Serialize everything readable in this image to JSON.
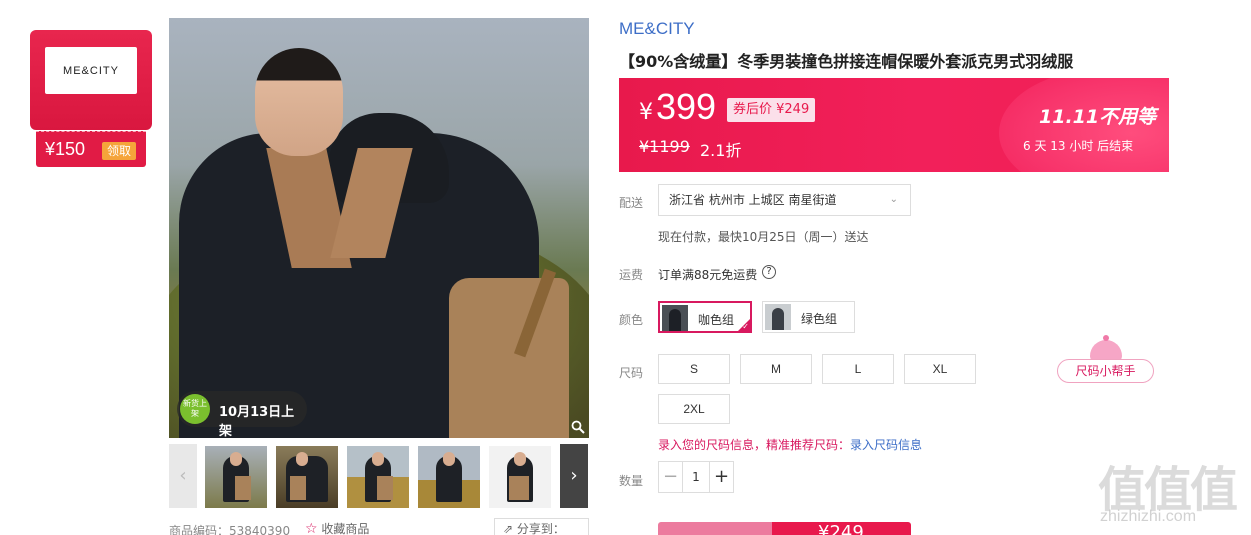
{
  "brand_coupon": {
    "logo_text": "ME&CITY",
    "value": "¥150",
    "claim_label": "领取"
  },
  "gallery": {
    "new_badge_dot": "新货上架",
    "new_badge_text": "10月13日上架",
    "thumbnails_count": 5
  },
  "product_meta": {
    "sku_label": "商品编码：53840390",
    "favorite_label": "收藏商品",
    "share_label": "分享到："
  },
  "brand_name": "ME&CITY",
  "title": "【90%含绒量】冬季男装撞色拼接连帽保暖外套派克男式羽绒服",
  "price": {
    "currency": "¥",
    "current": "399",
    "coupon_price": "券后价 ¥249",
    "original": "¥1199",
    "discount": "2.1折",
    "promo_title": "11.11不用等",
    "countdown": "6  天  13  小时  后结束"
  },
  "delivery": {
    "label": "配送",
    "address": "浙江省 杭州市 上城区 南星街道",
    "note": "现在付款，最快10月25日（周一）送达"
  },
  "freight": {
    "label": "运费",
    "text": "订单满88元免运费"
  },
  "colors": {
    "label": "颜色",
    "options": [
      "咖色组",
      "绿色组"
    ],
    "selected": "咖色组"
  },
  "sizes": {
    "label": "尺码",
    "options": [
      "S",
      "M",
      "L",
      "XL",
      "2XL"
    ],
    "helper": "尺码小帮手",
    "note": "录入您的尺码信息，精准推荐尺码：",
    "note_link": "录入尺码信息"
  },
  "quantity": {
    "label": "数量",
    "value": "1"
  },
  "buy": {
    "price": "¥249"
  },
  "watermark": {
    "glyphs": "值值值",
    "url": "zhizhizhi.com"
  }
}
